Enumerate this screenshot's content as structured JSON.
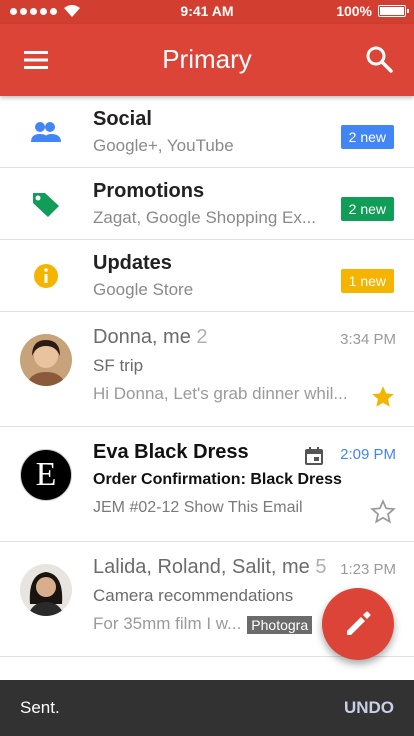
{
  "status_bar": {
    "time": "9:41 AM",
    "battery": "100%"
  },
  "appbar": {
    "title": "Primary"
  },
  "categories": [
    {
      "name": "Social",
      "sub": "Google+, YouTube",
      "badge": "2 new",
      "badge_color": "#4285f4",
      "icon": "people-icon"
    },
    {
      "name": "Promotions",
      "sub": "Zagat, Google Shopping Ex...",
      "badge": "2 new",
      "badge_color": "#0f9d58",
      "icon": "tag-icon"
    },
    {
      "name": "Updates",
      "sub": "Google Store",
      "badge": "1 new",
      "badge_color": "#f4b400",
      "icon": "info-icon"
    }
  ],
  "emails": [
    {
      "sender": "Donna, me",
      "count": "2",
      "time": "3:34 PM",
      "subject": "SF trip",
      "snippet": "Hi Donna, Let's grab dinner whil...",
      "starred": true
    },
    {
      "sender": "Eva Black Dress",
      "avatar_letter": "E",
      "time": "2:09 PM",
      "subject": "Order Confirmation: Black Dress",
      "snippet": "JEM #02-12 Show This Email",
      "starred": false
    },
    {
      "sender": "Lalida, Roland, Salit, me",
      "count": "5",
      "time": "1:23 PM",
      "subject": "Camera recommendations",
      "snippet": "For 35mm film I w...",
      "chip": "Photogra",
      "starred": false
    }
  ],
  "snackbar": {
    "message": "Sent.",
    "action": "UNDO"
  },
  "colors": {
    "red": "#db4437",
    "star_yellow": "#f4b400"
  }
}
